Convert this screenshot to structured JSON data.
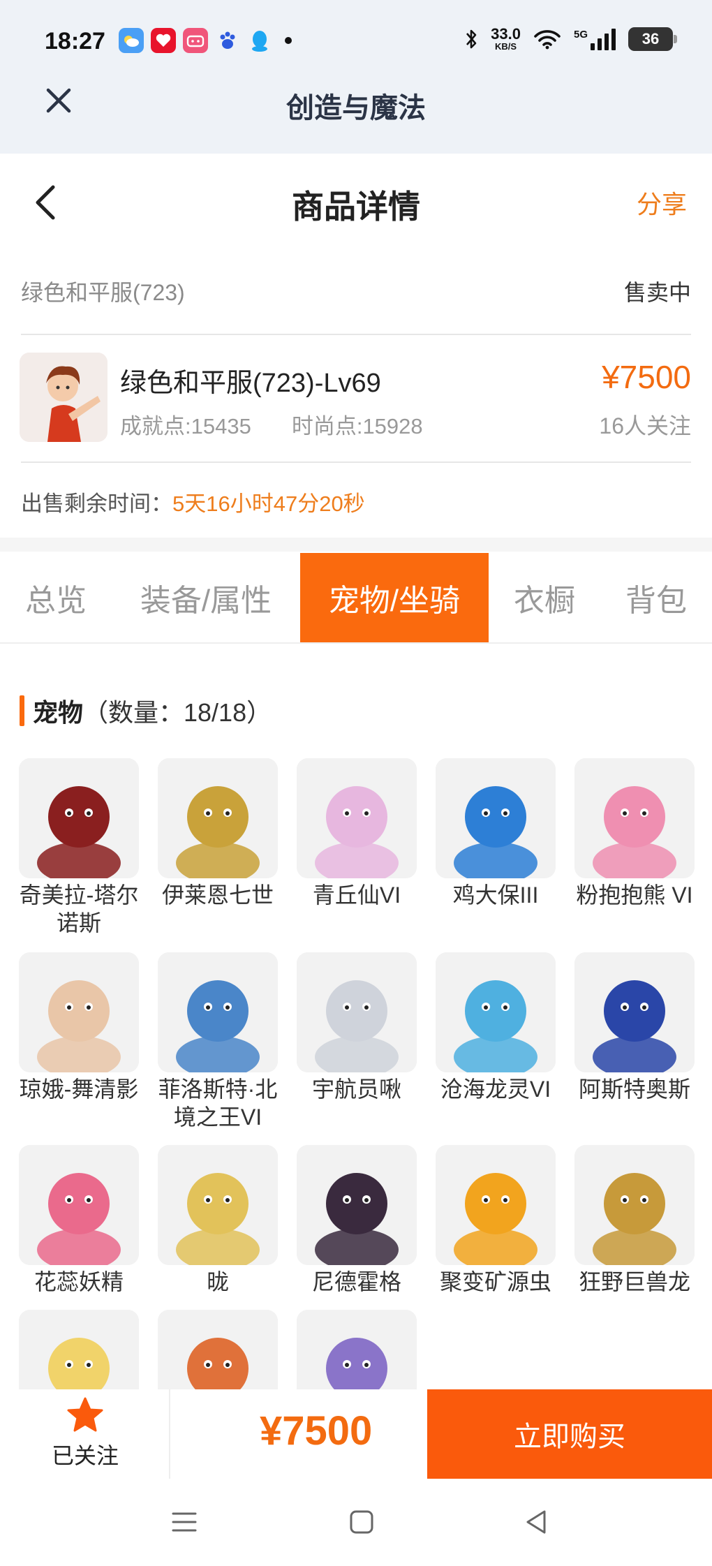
{
  "status_bar": {
    "time": "18:27",
    "net_speed_value": "33.0",
    "net_speed_unit": "KB/S",
    "network_type": "5G",
    "battery": "36",
    "notification_icons": [
      "weather-icon",
      "health-app-icon",
      "bilibili-icon",
      "baidu-icon",
      "qq-icon"
    ]
  },
  "app": {
    "title": "创造与魔法"
  },
  "header": {
    "title": "商品详情",
    "share_label": "分享"
  },
  "server": {
    "name": "绿色和平服(723)",
    "status": "售卖中"
  },
  "character": {
    "name": "绿色和平服(723)-Lv69",
    "achievement": "成就点:15435",
    "fashion": "时尚点:15928",
    "price": "¥7500",
    "followers": "16人关注"
  },
  "remaining": {
    "label": "出售剩余时间：",
    "time": "5天16小时47分20秒"
  },
  "tabs": [
    {
      "label": "总览",
      "active": false
    },
    {
      "label": "装备/属性",
      "active": false
    },
    {
      "label": "宠物/坐骑",
      "active": true
    },
    {
      "label": "衣橱",
      "active": false
    },
    {
      "label": "背包",
      "active": false
    }
  ],
  "pets_section": {
    "title": "宠物",
    "count": "（数量：18/18）"
  },
  "pets": [
    {
      "name": "奇美拉-塔尔诺斯",
      "color": "#8a1f1f"
    },
    {
      "name": "伊莱恩七世",
      "color": "#c9a23a"
    },
    {
      "name": "青丘仙VI",
      "color": "#e7b7df"
    },
    {
      "name": "鸡大保III",
      "color": "#2d7fd6"
    },
    {
      "name": "粉抱抱熊 VI",
      "color": "#ef8fb1"
    },
    {
      "name": "琼娥-舞清影",
      "color": "#e9c6a8"
    },
    {
      "name": "菲洛斯特·北境之王VI",
      "color": "#4a86c9"
    },
    {
      "name": "宇航员啾",
      "color": "#cfd3db"
    },
    {
      "name": "沧海龙灵VI",
      "color": "#4fb0e0"
    },
    {
      "name": "阿斯特奥斯",
      "color": "#2a46a8"
    },
    {
      "name": "花蕊妖精",
      "color": "#ea6a8c"
    },
    {
      "name": "昽",
      "color": "#e2c25a"
    },
    {
      "name": "尼德霍格",
      "color": "#3a2a3e"
    },
    {
      "name": "聚变矿源虫",
      "color": "#f2a41e"
    },
    {
      "name": "狂野巨兽龙",
      "color": "#c79a3a"
    },
    {
      "name": "",
      "color": "#f1d36a"
    },
    {
      "name": "",
      "color": "#e0713a"
    },
    {
      "name": "",
      "color": "#8a74c9"
    }
  ],
  "bottom": {
    "follow_label": "已关注",
    "price": "¥7500",
    "buy_label": "立即购买"
  },
  "colors": {
    "accent": "#fa6a0e",
    "price": "#f36b10",
    "highlight_text": "#ee7d1c"
  }
}
